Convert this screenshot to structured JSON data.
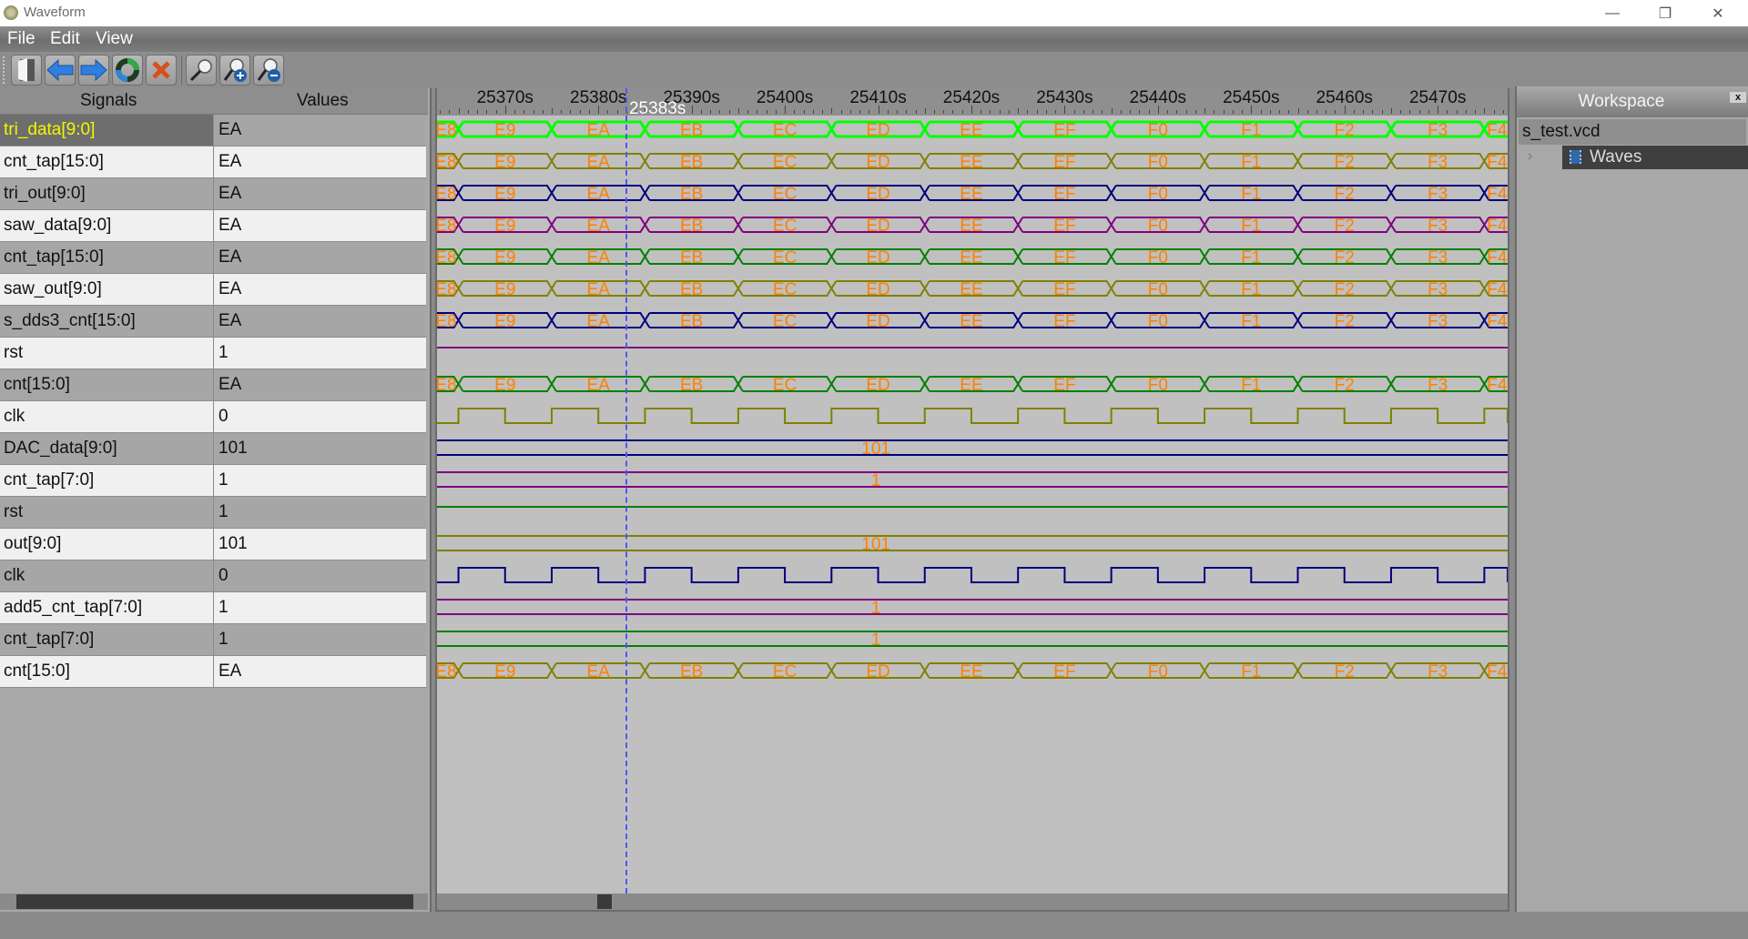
{
  "window": {
    "title": "Waveform",
    "controls": {
      "minimize": "—",
      "maximize": "❐",
      "close": "✕"
    }
  },
  "menu": [
    "File",
    "Edit",
    "View"
  ],
  "toolbar": {
    "buttons": [
      {
        "name": "open-button",
        "icon": "door-icon"
      },
      {
        "name": "back-button",
        "icon": "arrow-left-icon"
      },
      {
        "name": "forward-button",
        "icon": "arrow-right-icon"
      },
      {
        "name": "refresh-button",
        "icon": "refresh-icon"
      },
      {
        "name": "delete-button",
        "icon": "close-x-icon"
      },
      {
        "name": "zoom-fit-button",
        "icon": "magnifier-icon"
      },
      {
        "name": "zoom-in-button",
        "icon": "zoom-in-icon"
      },
      {
        "name": "zoom-out-button",
        "icon": "zoom-out-icon"
      }
    ]
  },
  "signals_panel": {
    "header_signals": "Signals",
    "header_values": "Values",
    "rows": [
      {
        "name": "tri_data[9:0]",
        "value": "EA",
        "selected": true
      },
      {
        "name": "cnt_tap[15:0]",
        "value": "EA"
      },
      {
        "name": "tri_out[9:0]",
        "value": "EA"
      },
      {
        "name": "saw_data[9:0]",
        "value": "EA"
      },
      {
        "name": "cnt_tap[15:0]",
        "value": "EA"
      },
      {
        "name": "saw_out[9:0]",
        "value": "EA"
      },
      {
        "name": "s_dds3_cnt[15:0]",
        "value": "EA"
      },
      {
        "name": "rst",
        "value": "1"
      },
      {
        "name": "cnt[15:0]",
        "value": "EA"
      },
      {
        "name": "clk",
        "value": "0"
      },
      {
        "name": "DAC_data[9:0]",
        "value": "101"
      },
      {
        "name": "cnt_tap[7:0]",
        "value": "1"
      },
      {
        "name": "rst",
        "value": "1"
      },
      {
        "name": "out[9:0]",
        "value": "101"
      },
      {
        "name": "clk",
        "value": "0"
      },
      {
        "name": "add5_cnt_tap[7:0]",
        "value": "1"
      },
      {
        "name": "cnt_tap[7:0]",
        "value": "1"
      },
      {
        "name": "cnt[15:0]",
        "value": "EA"
      }
    ]
  },
  "waveform": {
    "time_unit": "s",
    "view_start": 25362.7,
    "view_end": 25477.5,
    "major_ticks": [
      25370,
      25380,
      25390,
      25400,
      25410,
      25420,
      25430,
      25440,
      25450,
      25460,
      25470
    ],
    "tick_labels": [
      "25370s",
      "25380s",
      "25390s",
      "25400s",
      "25410s",
      "25420s",
      "25430s",
      "25440s",
      "25450s",
      "25460s",
      "25470s"
    ],
    "cursor_time": 25383,
    "cursor_label": "25383s",
    "bus_segments": {
      "transitions": [
        25365,
        25375,
        25385,
        25395,
        25405,
        25415,
        25425,
        25435,
        25445,
        25455,
        25465,
        25475
      ],
      "values": [
        "E8",
        "E9",
        "EA",
        "EB",
        "EC",
        "ED",
        "EE",
        "EF",
        "F0",
        "F1",
        "F2",
        "F3",
        "F4"
      ]
    },
    "clock": {
      "period": 10,
      "first_rise": 25365,
      "high_time": 5
    },
    "label_color": "#ff8000",
    "traces": [
      {
        "kind": "bus",
        "color": "#00ff00",
        "thick": true
      },
      {
        "kind": "bus",
        "color": "#808000"
      },
      {
        "kind": "bus",
        "color": "#000080"
      },
      {
        "kind": "bus",
        "color": "#800080"
      },
      {
        "kind": "bus",
        "color": "#008000"
      },
      {
        "kind": "bus",
        "color": "#808000"
      },
      {
        "kind": "bus",
        "color": "#000080"
      },
      {
        "kind": "bit1",
        "color": "#800080"
      },
      {
        "kind": "bus",
        "color": "#008000"
      },
      {
        "kind": "clock",
        "color": "#808000"
      },
      {
        "kind": "const",
        "color": "#000080",
        "label": "101"
      },
      {
        "kind": "const",
        "color": "#800080",
        "label": "1"
      },
      {
        "kind": "bit1",
        "color": "#008000"
      },
      {
        "kind": "const",
        "color": "#808000",
        "label": "101"
      },
      {
        "kind": "clock",
        "color": "#000080"
      },
      {
        "kind": "const",
        "color": "#800080",
        "label": "1"
      },
      {
        "kind": "const",
        "color": "#008000",
        "label": "1"
      },
      {
        "kind": "bus",
        "color": "#808000"
      }
    ],
    "scroll_position": 0.15
  },
  "workspace": {
    "title": "Workspace",
    "close": "x",
    "file": "s_test.vcd",
    "node": "Waves"
  }
}
